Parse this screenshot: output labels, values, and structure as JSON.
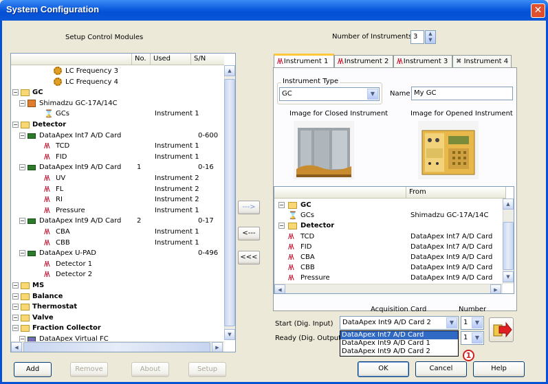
{
  "window": {
    "title": "System Configuration"
  },
  "left": {
    "caption": "Setup Control Modules",
    "columns": [
      "",
      "No.",
      "Used",
      "S/N"
    ],
    "tree": [
      {
        "label": "LC Frequency 3",
        "icon": "gear-icon",
        "no": "",
        "used": "",
        "sn": ""
      },
      {
        "label": "LC Frequency 4",
        "icon": "gear-icon",
        "no": "",
        "used": "",
        "sn": ""
      },
      {
        "label": "GC",
        "icon": "folder-icon",
        "no": "",
        "used": "",
        "sn": ""
      },
      {
        "label": "Shimadzu GC-17A/14C",
        "icon": "instrument-icon",
        "no": "",
        "used": "",
        "sn": ""
      },
      {
        "label": "GCs",
        "icon": "hourglass-icon",
        "no": "",
        "used": "Instrument 1",
        "sn": ""
      },
      {
        "label": "Detector",
        "icon": "folder-icon",
        "no": "",
        "used": "",
        "sn": ""
      },
      {
        "label": "DataApex Int7 A/D Card",
        "icon": "card-icon",
        "no": "",
        "used": "",
        "sn": "0-600"
      },
      {
        "label": "TCD",
        "icon": "signal-icon",
        "no": "",
        "used": "Instrument 1",
        "sn": ""
      },
      {
        "label": "FID",
        "icon": "signal-icon",
        "no": "",
        "used": "Instrument 1",
        "sn": ""
      },
      {
        "label": "DataApex Int9 A/D Card",
        "icon": "card-icon",
        "no": "1",
        "used": "",
        "sn": "0-16"
      },
      {
        "label": "UV",
        "icon": "signal-icon",
        "no": "",
        "used": "Instrument 2",
        "sn": ""
      },
      {
        "label": "FL",
        "icon": "signal-icon",
        "no": "",
        "used": "Instrument 2",
        "sn": ""
      },
      {
        "label": "RI",
        "icon": "signal-icon",
        "no": "",
        "used": "Instrument 2",
        "sn": ""
      },
      {
        "label": "Pressure",
        "icon": "signal-icon",
        "no": "",
        "used": "Instrument 1",
        "sn": ""
      },
      {
        "label": "DataApex Int9 A/D Card",
        "icon": "card-icon",
        "no": "2",
        "used": "",
        "sn": "0-17"
      },
      {
        "label": "CBA",
        "icon": "signal-icon",
        "no": "",
        "used": "Instrument 1",
        "sn": ""
      },
      {
        "label": "CBB",
        "icon": "signal-icon",
        "no": "",
        "used": "Instrument 1",
        "sn": ""
      },
      {
        "label": "DataApex U-PAD",
        "icon": "card-icon",
        "no": "",
        "used": "",
        "sn": "0-496"
      },
      {
        "label": "Detector 1",
        "icon": "signal-icon",
        "no": "",
        "used": "",
        "sn": ""
      },
      {
        "label": "Detector 2",
        "icon": "signal-icon",
        "no": "",
        "used": "",
        "sn": ""
      },
      {
        "label": "MS",
        "icon": "folder-icon",
        "no": "",
        "used": "",
        "sn": ""
      },
      {
        "label": "Balance",
        "icon": "folder-icon",
        "no": "",
        "used": "",
        "sn": ""
      },
      {
        "label": "Thermostat",
        "icon": "folder-icon",
        "no": "",
        "used": "",
        "sn": ""
      },
      {
        "label": "Valve",
        "icon": "folder-icon",
        "no": "",
        "used": "",
        "sn": ""
      },
      {
        "label": "Fraction Collector",
        "icon": "folder-icon",
        "no": "",
        "used": "",
        "sn": ""
      },
      {
        "label": "DataApex Virtual FC",
        "icon": "fc-icon",
        "no": "",
        "used": "",
        "sn": ""
      }
    ],
    "buttons": {
      "add": "Add",
      "remove": "Remove",
      "about": "About",
      "setup": "Setup"
    }
  },
  "transfer": {
    "add": "--->",
    "remove": "<---",
    "remove_all": "<<<"
  },
  "right": {
    "num_instruments_label": "Number of Instruments",
    "num_instruments_value": "3",
    "tabs": [
      "Instrument 1",
      "Instrument 2",
      "Instrument 3",
      "Instrument 4"
    ],
    "instrument_type_label": "Instrument Type",
    "instrument_type_value": "GC",
    "name_label": "Name",
    "name_value": "My GC",
    "closed_image_label": "Image for Closed Instrument",
    "opened_image_label": "Image for Opened Instrument",
    "list_columns": [
      "",
      "From"
    ],
    "list": [
      {
        "label": "GC",
        "from": ""
      },
      {
        "label": "GCs",
        "from": "Shimadzu GC-17A/14C"
      },
      {
        "label": "Detector",
        "from": ""
      },
      {
        "label": "TCD",
        "from": "DataApex Int7 A/D Card"
      },
      {
        "label": "FID",
        "from": "DataApex Int7 A/D Card"
      },
      {
        "label": "CBA",
        "from": "DataApex Int9 A/D Card"
      },
      {
        "label": "CBB",
        "from": "DataApex Int9 A/D Card"
      },
      {
        "label": "Pressure",
        "from": "DataApex Int9 A/D Card"
      }
    ],
    "acq_card_label": "Acquisition Card",
    "number_label": "Number",
    "start_label": "Start (Dig. Input)",
    "ready_label": "Ready (Dig. Output)",
    "start_card_value": "DataApex Int9 A/D Card  2",
    "start_number_value": "1",
    "ready_number_value": "1",
    "dropdown_options": [
      "DataApex Int7 A/D Card",
      "DataApex Int9 A/D Card  1",
      "DataApex Int9 A/D Card  2"
    ],
    "badge": "1"
  },
  "footer": {
    "ok": "OK",
    "cancel": "Cancel",
    "help": "Help"
  }
}
